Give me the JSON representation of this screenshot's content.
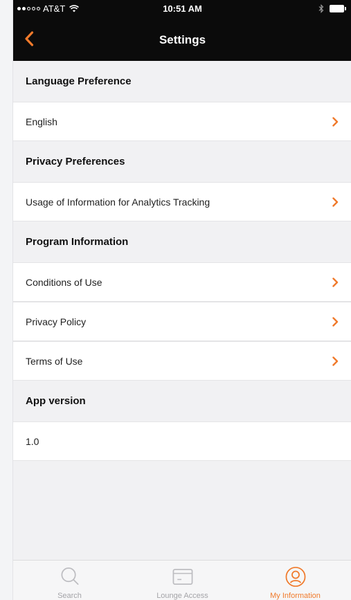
{
  "status_bar": {
    "carrier": "AT&T",
    "time": "10:51 AM"
  },
  "nav": {
    "title": "Settings"
  },
  "sections": [
    {
      "title": "Language Preference",
      "rows": [
        {
          "label": "English",
          "chevron": true
        }
      ]
    },
    {
      "title": "Privacy Preferences",
      "rows": [
        {
          "label": "Usage of Information for Analytics Tracking",
          "chevron": true
        }
      ]
    },
    {
      "title": "Program Information",
      "rows": [
        {
          "label": "Conditions of Use",
          "chevron": true
        },
        {
          "label": "Privacy Policy",
          "chevron": true
        },
        {
          "label": "Terms of Use",
          "chevron": true
        }
      ]
    },
    {
      "title": "App version",
      "rows": [
        {
          "label": "1.0",
          "chevron": false
        }
      ]
    }
  ],
  "tabs": [
    {
      "label": "Search",
      "icon": "search-icon",
      "active": false
    },
    {
      "label": "Lounge Access",
      "icon": "card-icon",
      "active": false
    },
    {
      "label": "My Information",
      "icon": "user-icon",
      "active": true
    }
  ],
  "colors": {
    "accent": "#f07a2b",
    "header_bg": "#0b0b0b",
    "page_bg": "#f1f1f3",
    "inactive_tab": "#a4a4a8"
  }
}
